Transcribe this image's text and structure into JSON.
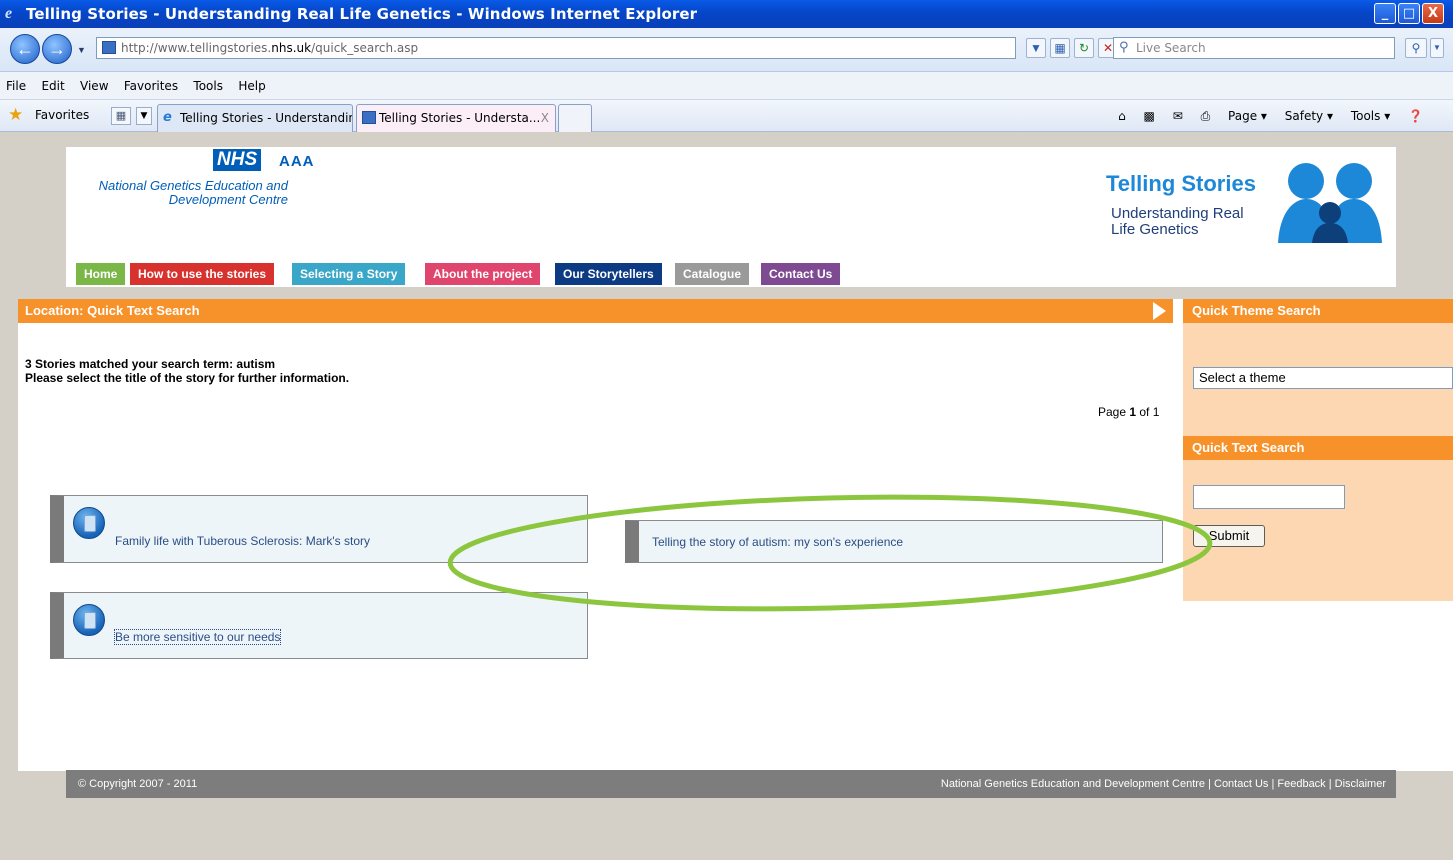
{
  "window": {
    "title": "Telling Stories - Understanding Real Life Genetics - Windows Internet Explorer",
    "min": "_",
    "max": "□",
    "close": "X"
  },
  "address": {
    "url_pre": "http://www.tellingstories.",
    "url_bold": "nhs.uk",
    "url_post": "/quick_search.asp",
    "search_placeholder": "Live Search"
  },
  "menu": [
    "File",
    "Edit",
    "View",
    "Favorites",
    "Tools",
    "Help"
  ],
  "favbar": {
    "favorites": "Favorites",
    "tabs": [
      "Telling Stories - Understandin...",
      "Telling Stories - Understa..."
    ],
    "close_tab": "X",
    "tools": [
      "Page ▾",
      "Safety ▾",
      "Tools ▾"
    ]
  },
  "header": {
    "nhs": "NHS",
    "aaa": "AAA",
    "org_line1": "National Genetics Education and",
    "org_line2": "Development Centre",
    "site_title": "Telling Stories",
    "site_sub1": "Understanding Real",
    "site_sub2": "Life Genetics"
  },
  "nav": [
    {
      "label": "Home",
      "color": "#7ab648"
    },
    {
      "label": "How to use the stories",
      "color": "#d8322f"
    },
    {
      "label": "Selecting a Story",
      "color": "#3aa6c8"
    },
    {
      "label": "About the project",
      "color": "#e0456e"
    },
    {
      "label": "Our Storytellers",
      "color": "#0c3b84"
    },
    {
      "label": "Catalogue",
      "color": "#9a9a9a"
    },
    {
      "label": "Contact Us",
      "color": "#7e4a91"
    }
  ],
  "main": {
    "location": "Location: Quick Text Search",
    "result_line1": "3 Stories matched your search term: autism",
    "result_line2": "Please select the title of the story for further information.",
    "page_label": "Page ",
    "page_current": "1",
    "page_total": " of 1"
  },
  "stories": [
    {
      "title": "Family life with Tuberous Sclerosis: Mark's story"
    },
    {
      "title": "Telling the story of autism: my son's experience"
    },
    {
      "title": "Be more sensitive to our needs"
    }
  ],
  "sidebar": {
    "theme_heading": "Quick Theme Search",
    "theme_select": "Select a theme",
    "text_heading": "Quick Text Search",
    "submit": "Submit"
  },
  "footer": {
    "copyright": "© Copyright 2007 - 2011",
    "links": "National Genetics Education and Development Centre  | Contact Us  | Feedback  | Disclaimer"
  },
  "colors": {
    "accent_orange": "#f7922b",
    "annotation_green": "#8cc63f"
  }
}
